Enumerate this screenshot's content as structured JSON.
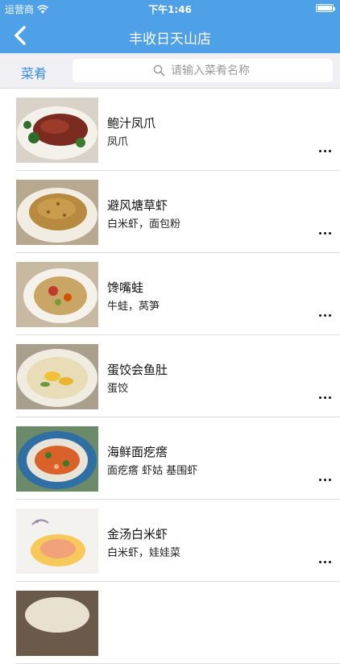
{
  "status_bar": {
    "carrier": "运营商",
    "time": "下午1:46"
  },
  "nav": {
    "title": "丰收日天山店"
  },
  "search": {
    "category_label": "菜肴",
    "placeholder": "请输入菜肴名称",
    "value": ""
  },
  "dishes": [
    {
      "name": "鲍汁凤爪",
      "ingredients": "凤爪"
    },
    {
      "name": "避风塘草虾",
      "ingredients": "白米虾，面包粉"
    },
    {
      "name": "馋嘴蛙",
      "ingredients": "牛蛙，莴笋"
    },
    {
      "name": "蛋饺会鱼肚",
      "ingredients": "蛋饺"
    },
    {
      "name": "海鲜面疙瘩",
      "ingredients": "面疙瘩 虾姑 基围虾"
    },
    {
      "name": "金汤白米虾",
      "ingredients": "白米虾，娃娃菜"
    },
    {
      "name": "",
      "ingredients": ""
    }
  ],
  "colors": {
    "accent": "#4ea1e6",
    "link": "#3a8fd8"
  },
  "icons": {
    "back": "chevron-left-icon",
    "search": "search-icon",
    "more": "ellipsis-icon",
    "wifi": "wifi-icon",
    "battery": "battery-icon"
  }
}
